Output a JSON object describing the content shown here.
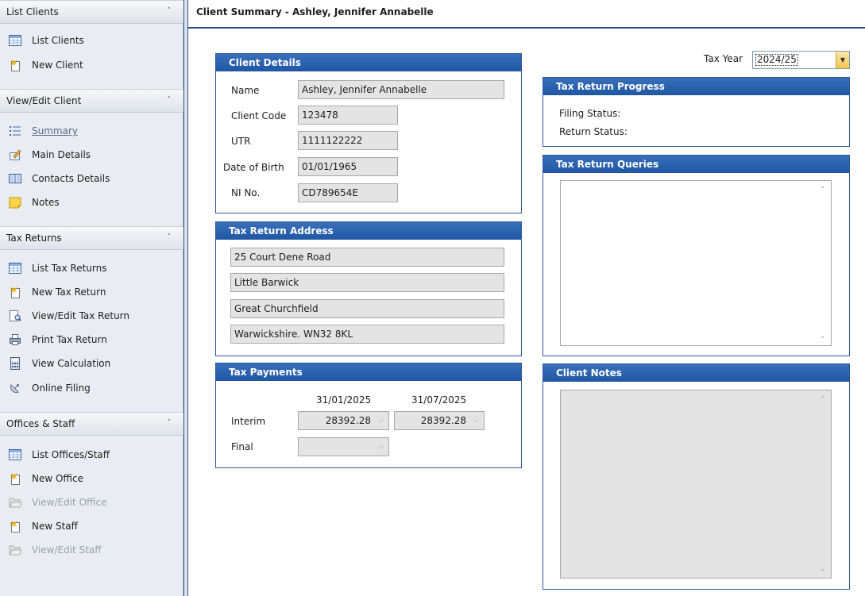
{
  "page_title": "Client Summary - Ashley, Jennifer Annabelle",
  "sidebar": {
    "groups": [
      {
        "header": "List Clients",
        "items": [
          {
            "label": "List Clients",
            "icon": "grid-icon"
          },
          {
            "label": "New Client",
            "icon": "new-doc-icon"
          }
        ]
      },
      {
        "header": "View/Edit Client",
        "items": [
          {
            "label": "Summary",
            "icon": "list-icon",
            "active": true
          },
          {
            "label": "Main Details",
            "icon": "edit-icon"
          },
          {
            "label": "Contacts Details",
            "icon": "book-icon"
          },
          {
            "label": "Notes",
            "icon": "note-icon"
          }
        ]
      },
      {
        "header": "Tax Returns",
        "items": [
          {
            "label": "List Tax Returns",
            "icon": "grid-icon"
          },
          {
            "label": "New Tax Return",
            "icon": "new-doc-icon"
          },
          {
            "label": "View/Edit Tax Return",
            "icon": "view-edit-icon"
          },
          {
            "label": "Print Tax Return",
            "icon": "printer-icon"
          },
          {
            "label": "View Calculation",
            "icon": "calculator-icon"
          },
          {
            "label": "Online Filing",
            "icon": "satellite-icon"
          }
        ]
      },
      {
        "header": "Offices & Staff",
        "items": [
          {
            "label": "List Offices/Staff",
            "icon": "grid-icon"
          },
          {
            "label": "New Office",
            "icon": "new-doc-icon"
          },
          {
            "label": "View/Edit Office",
            "icon": "folder-open-icon",
            "disabled": true
          },
          {
            "label": "New Staff",
            "icon": "new-doc-icon"
          },
          {
            "label": "View/Edit Staff",
            "icon": "folder-open-icon",
            "disabled": true
          }
        ]
      }
    ]
  },
  "tax_year": {
    "label": "Tax Year",
    "value": "2024/25"
  },
  "client_details": {
    "title": "Client Details",
    "name_label": "Name",
    "name": "Ashley, Jennifer Annabelle",
    "code_label": "Client Code",
    "code": "123478",
    "utr_label": "UTR",
    "utr": "1111122222",
    "dob_label": "Date of Birth",
    "dob": "01/01/1965",
    "ni_label": "NI No.",
    "ni": "CD789654E"
  },
  "address": {
    "title": "Tax Return Address",
    "lines": [
      "25 Court Dene Road",
      "Little Barwick",
      "Great Churchfield",
      "Warwickshire. WN32 8KL"
    ]
  },
  "payments": {
    "title": "Tax Payments",
    "date1": "31/01/2025",
    "date2": "31/07/2025",
    "interim_label": "Interim",
    "interim1": "28392.28",
    "interim2": "28392.28",
    "final_label": "Final",
    "final1": ""
  },
  "progress": {
    "title": "Tax Return Progress",
    "filing_label": "Filing Status:",
    "return_label": "Return Status:"
  },
  "queries": {
    "title": "Tax Return Queries"
  },
  "notes": {
    "title": "Client Notes"
  }
}
